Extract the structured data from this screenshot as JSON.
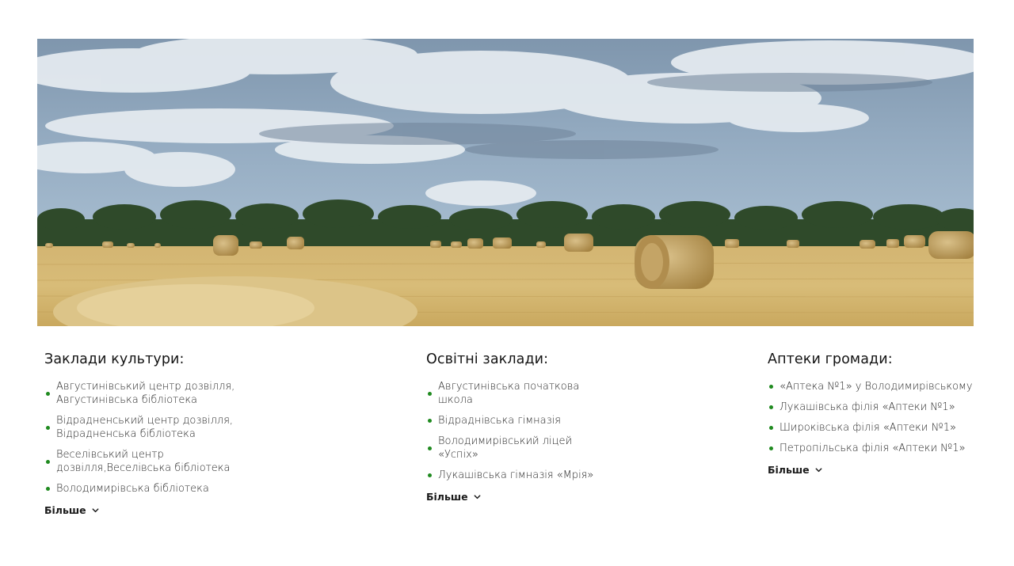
{
  "hero": {
    "image_description_icon": "field-hay-bales-image"
  },
  "sections": [
    {
      "title": "Заклади культури:",
      "items": [
        {
          "line1": "Августинівський центр дозвілля,",
          "line2": "Августинівська бібліотека"
        },
        {
          "line1": "Відрадненський центр дозвілля,",
          "line2": "Відрадненська бібліотека"
        },
        {
          "line1": "Веселівський центр",
          "line2": "дозвілля,Веселівська бібліотека"
        },
        {
          "line1": "Володимирівська бібліотека",
          "line2": ""
        }
      ],
      "more_label": "Більше"
    },
    {
      "title": "Освітні заклади:",
      "items": [
        {
          "line1": "Августинівська початкова",
          "line2": "школа"
        },
        {
          "line1": "Відраднівська гімназія",
          "line2": ""
        },
        {
          "line1": "Володимирівський ліцей",
          "line2": "«Успіх»"
        },
        {
          "line1": "Лукашівська гімназія «Мрія»",
          "line2": ""
        }
      ],
      "more_label": "Більше"
    },
    {
      "title": "Аптеки громади:",
      "items": [
        {
          "line1": "«Аптека №1» у Володимирівському",
          "line2": ""
        },
        {
          "line1": "Лукашівська філія «Аптеки №1»",
          "line2": ""
        },
        {
          "line1": "Широківська філія «Аптеки №1»",
          "line2": ""
        },
        {
          "line1": "Петропільська філія «Аптеки №1»",
          "line2": ""
        }
      ],
      "more_label": "Більше"
    }
  ],
  "colors": {
    "bullet": "#1f8a1f",
    "heading": "#141414",
    "text": "#262626"
  }
}
